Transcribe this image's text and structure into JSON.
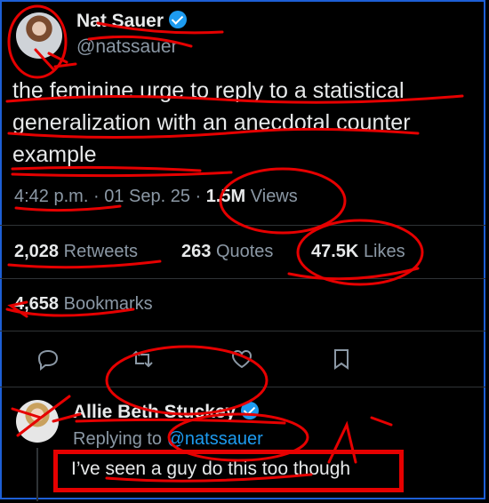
{
  "author": {
    "name": "Nat Sauer",
    "handle": "@natssauer"
  },
  "tweet": {
    "text": "the feminine urge to reply to a statistical generalization with an anecdotal counter example",
    "time": "4:42 p.m.",
    "separator": "·",
    "date": "01 Sep. 25",
    "views_count": "1.5M",
    "views_label": "Views"
  },
  "stats": {
    "retweets_count": "2,028",
    "retweets_label": "Retweets",
    "quotes_count": "263",
    "quotes_label": "Quotes",
    "likes_count": "47.5K",
    "likes_label": "Likes",
    "bookmarks_count": "4,658",
    "bookmarks_label": "Bookmarks"
  },
  "actions": [
    "reply-icon",
    "retweet-icon",
    "like-icon",
    "bookmark-icon"
  ],
  "reply": {
    "name": "Allie Beth Stuckey",
    "replying_to_label": "Replying to",
    "replying_to_handle": "@natssauer",
    "text": "I’ve seen a guy do this too though"
  },
  "colors": {
    "background": "#000000",
    "text": "#e7e9ea",
    "muted": "#8b98a5",
    "accent": "#1d9bf0",
    "annotation": "#e60000",
    "frame": "#1d5fd6"
  }
}
